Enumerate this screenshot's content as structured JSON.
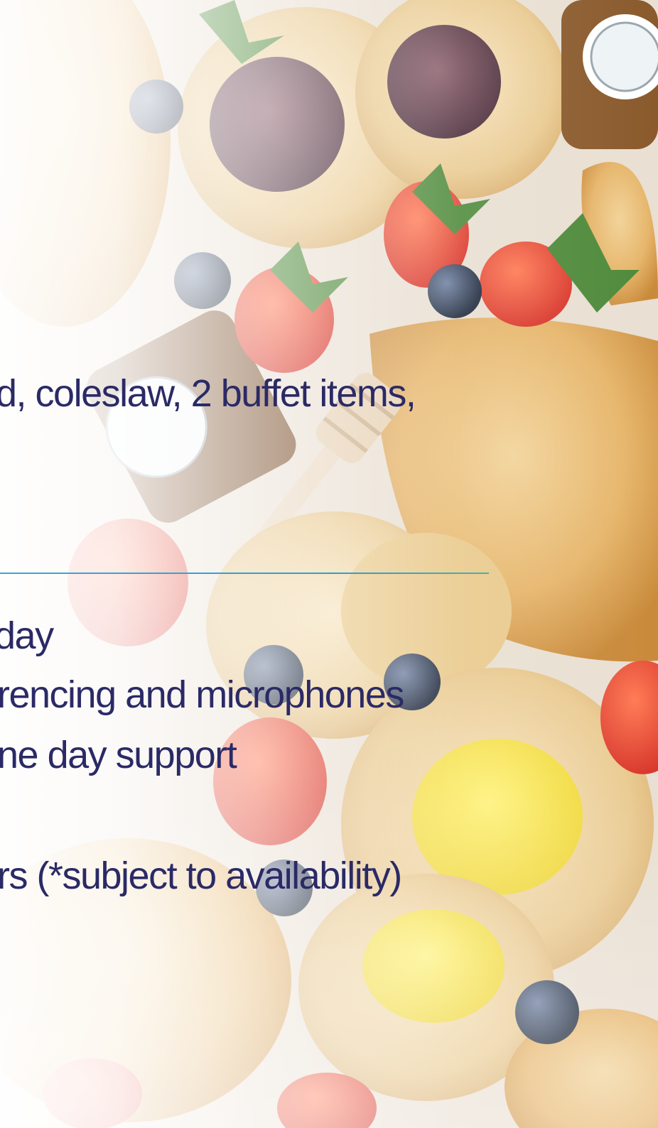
{
  "lines": {
    "catering": "d, coleslaw, 2 buffet items,",
    "day": " day",
    "conferencing": "rencing and microphones",
    "support": "ne day support",
    "availability": "rs (*subject to availability)"
  },
  "colors": {
    "text": "#2b2a66",
    "rule": "#2f9dd2"
  }
}
